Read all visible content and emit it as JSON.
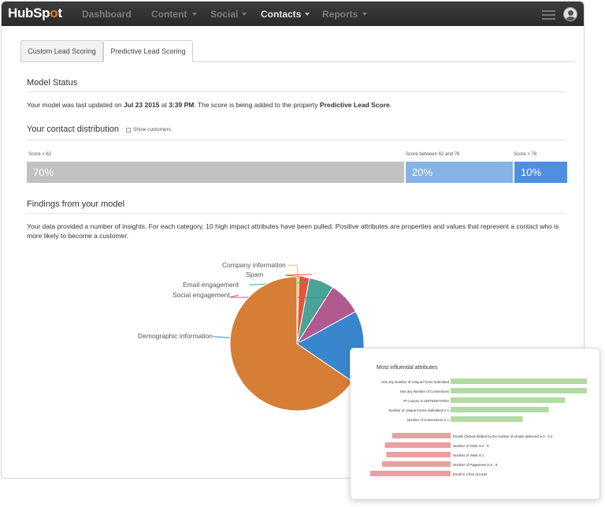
{
  "nav": {
    "logo_prefix": "HubSp",
    "logo_sprocket": "o",
    "logo_suffix": "t",
    "items": [
      {
        "label": "Dashboard",
        "has_menu": false
      },
      {
        "label": "Content",
        "has_menu": true
      },
      {
        "label": "Social",
        "has_menu": true
      },
      {
        "label": "Contacts",
        "has_menu": true,
        "active": true
      },
      {
        "label": "Reports",
        "has_menu": true
      }
    ],
    "menu_icon": "hamburger-icon",
    "avatar_icon": "user-avatar-icon"
  },
  "tabs": [
    {
      "label": "Custom Lead Scoring",
      "active": false
    },
    {
      "label": "Predictive Lead Scoring",
      "active": true
    }
  ],
  "model_status": {
    "title": "Model Status",
    "text_pre": "Your model was last updated on ",
    "date": "Jul 23 2015",
    "text_at": " at ",
    "time": "3:39 PM",
    "text_mid": ". The score is being added to the property ",
    "property": "Predictive Lead Score",
    "text_end": "."
  },
  "distribution": {
    "title": "Your contact distribution",
    "show_customers_label": "Show customers",
    "show_customers_checked": false,
    "segments": [
      {
        "label": "Score < 62",
        "value": "70%",
        "share": 0.7,
        "color": "#c1c1c1"
      },
      {
        "label": "Score between 62 and 76",
        "value": "20%",
        "share": 0.2,
        "color": "#86b3e6"
      },
      {
        "label": "Score > 76",
        "value": "10%",
        "share": 0.1,
        "color": "#4f8fe0"
      }
    ]
  },
  "findings": {
    "title": "Findings from your model",
    "text": "Your data provided a number of insights. For each category, 10 high impact attributes have been pulled. Positive attributes are properties and values that represent a contact who is more likely to become a customer."
  },
  "chart_data": [
    {
      "type": "pie",
      "title": "",
      "labels": [
        "Company information",
        "Spam",
        "Email engagement",
        "Social engagement",
        "Demographic information",
        ""
      ],
      "values": [
        0.5,
        2.5,
        6,
        8,
        17.5,
        65.5
      ],
      "colors": [
        "#f0c419",
        "#e5533b",
        "#4aa396",
        "#b15a8f",
        "#3a86cc",
        "#d67d36"
      ]
    },
    {
      "type": "bar",
      "title": "Most influential attributes",
      "orientation": "horizontal",
      "categories": [
        "Has any Number of Unique Forms Submitted",
        "Has any Number of Conversions",
        "IP Country is UNITEDSTATES",
        "Number of Unique Forms Submitted is 1",
        "Number of Conversions is 1",
        "Emails Clicked divided by the number of emails delivered is 0 - 0.1",
        "Number of Visits is 2 - 5",
        "Number of Visits is 1",
        "Number of Pageviews is 5 - 8",
        "Email is a free account"
      ],
      "values": [
        1.0,
        1.0,
        0.84,
        0.72,
        0.53,
        -0.4,
        -0.45,
        -0.44,
        -0.47,
        -0.55
      ],
      "positive_color": "#b3dba3",
      "negative_color": "#e8a1a1"
    }
  ]
}
